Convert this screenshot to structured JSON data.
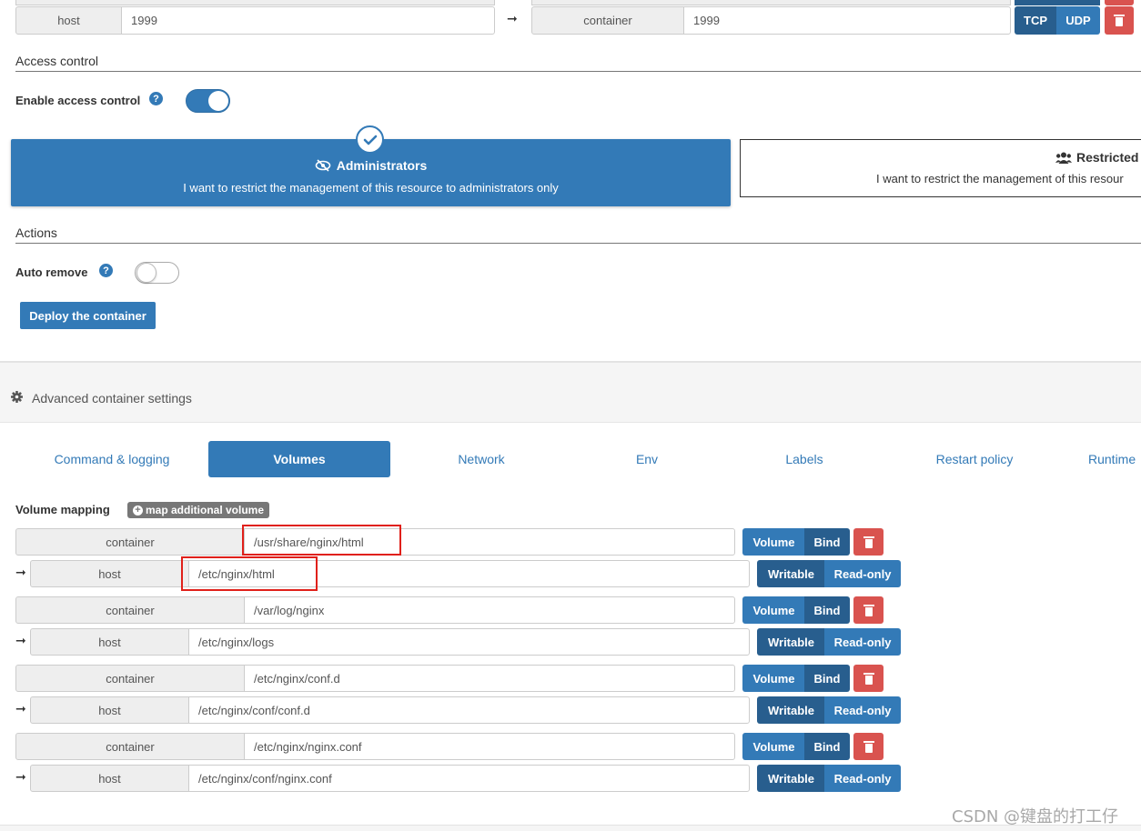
{
  "ports": {
    "host_label": "host",
    "host_value": "1999",
    "container_label": "container",
    "container_value": "1999",
    "tcp_label": "TCP",
    "udp_label": "UDP"
  },
  "access_control": {
    "section_title": "Access control",
    "enable_label": "Enable access control",
    "enabled": true,
    "administrators": {
      "title": "Administrators",
      "description": "I want to restrict the management of this resource to administrators only"
    },
    "restricted": {
      "title": "Restricted",
      "description": "I want to restrict the management of this resour"
    }
  },
  "actions": {
    "section_title": "Actions",
    "auto_remove_label": "Auto remove",
    "auto_remove": false,
    "deploy_label": "Deploy the container"
  },
  "advanced": {
    "title": "Advanced container settings",
    "tabs": [
      "Command & logging",
      "Volumes",
      "Network",
      "Env",
      "Labels",
      "Restart policy",
      "Runtime"
    ],
    "active_tab": "Volumes"
  },
  "volume_mapping": {
    "label": "Volume mapping",
    "add_label": "map additional volume",
    "container_label": "container",
    "host_label": "host",
    "volume_label": "Volume",
    "bind_label": "Bind",
    "writable_label": "Writable",
    "readonly_label": "Read-only",
    "rows": [
      {
        "container": "/usr/share/nginx/html",
        "host": "/etc/nginx/html"
      },
      {
        "container": "/var/log/nginx",
        "host": "/etc/nginx/logs"
      },
      {
        "container": "/etc/nginx/conf.d",
        "host": "/etc/nginx/conf/conf.d"
      },
      {
        "container": "/etc/nginx/nginx.conf",
        "host": "/etc/nginx/conf/nginx.conf"
      }
    ]
  },
  "watermark": "CSDN @键盘的打工仔",
  "colors": {
    "primary": "#337ab7",
    "primary_dark": "#285e8e",
    "danger": "#d9534f",
    "highlight": "#e0201a"
  }
}
